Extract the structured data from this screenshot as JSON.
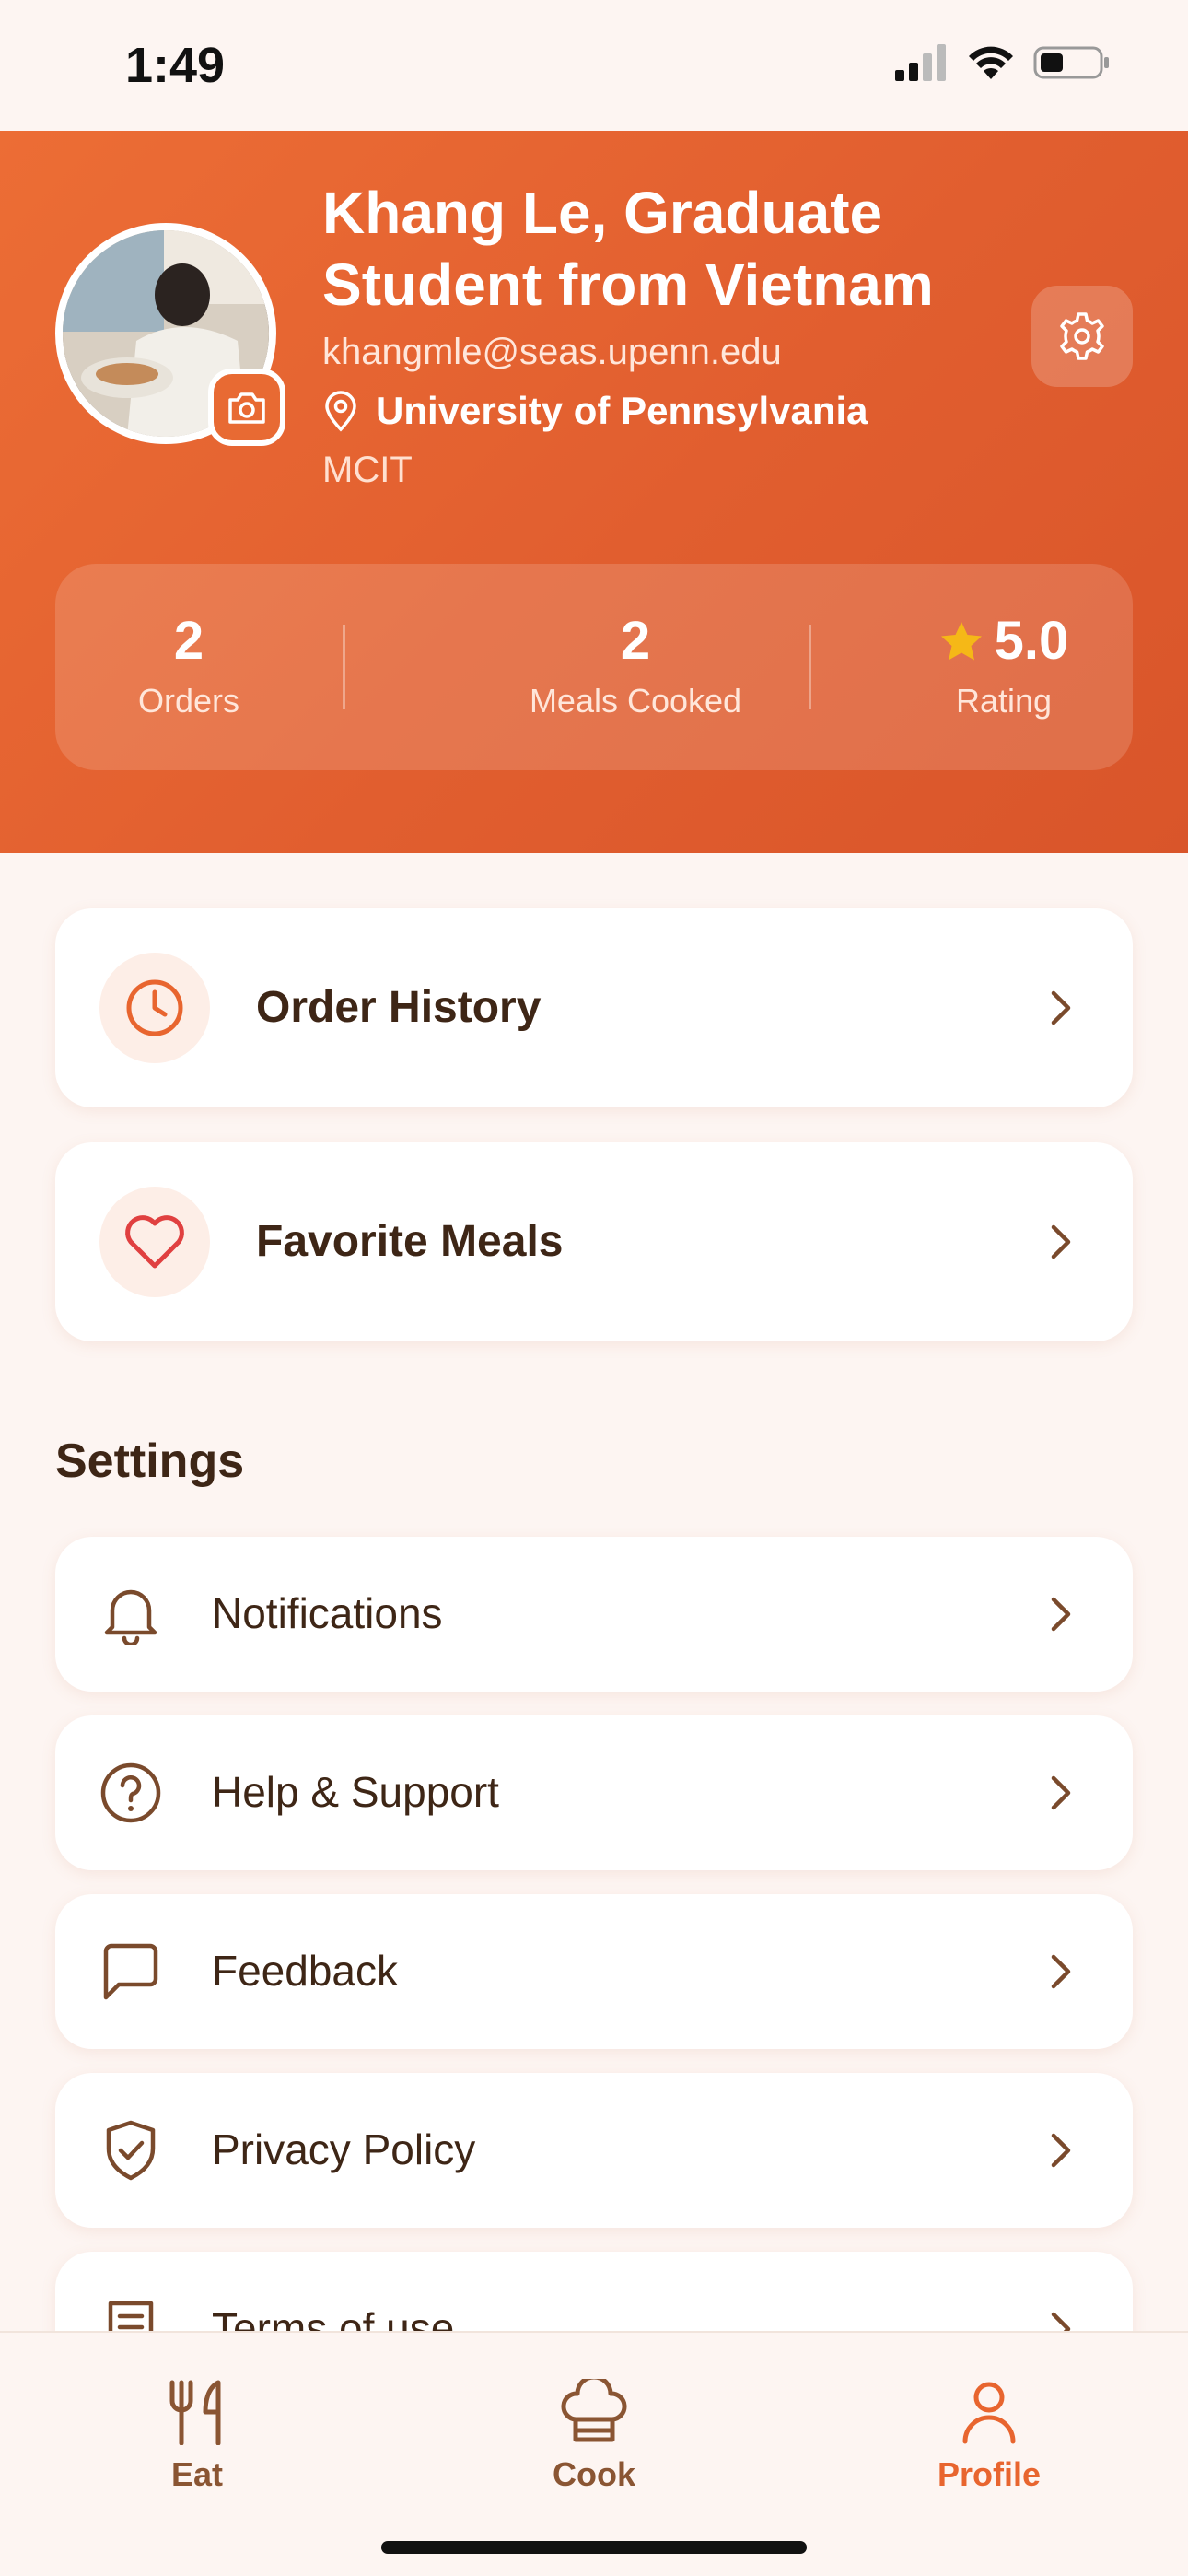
{
  "status": {
    "time": "1:49"
  },
  "profile": {
    "name": "Khang Le, Graduate Student from Vietnam",
    "email": "khangmle@seas.upenn.edu",
    "university": "University of Pennsylvania",
    "program": "MCIT"
  },
  "stats": {
    "orders_value": "2",
    "orders_label": "Orders",
    "meals_value": "2",
    "meals_label": "Meals Cooked",
    "rating_value": "5.0",
    "rating_label": "Rating"
  },
  "quick_links": [
    {
      "label": "Order History",
      "icon": "clock-icon"
    },
    {
      "label": "Favorite Meals",
      "icon": "heart-icon"
    }
  ],
  "settings": {
    "title": "Settings",
    "items": [
      {
        "label": "Notifications",
        "icon": "bell-icon"
      },
      {
        "label": "Help & Support",
        "icon": "question-icon"
      },
      {
        "label": "Feedback",
        "icon": "chat-icon"
      },
      {
        "label": "Privacy Policy",
        "icon": "shield-icon"
      },
      {
        "label": "Terms of use",
        "icon": "document-icon"
      }
    ]
  },
  "tabs": [
    {
      "label": "Eat",
      "icon": "utensils-icon"
    },
    {
      "label": "Cook",
      "icon": "chef-hat-icon"
    },
    {
      "label": "Profile",
      "icon": "person-icon",
      "active": true
    }
  ],
  "colors": {
    "accent": "#E8652F",
    "brown": "#7A4A2C",
    "bg": "#FDF5F2",
    "star": "#F5B817"
  }
}
